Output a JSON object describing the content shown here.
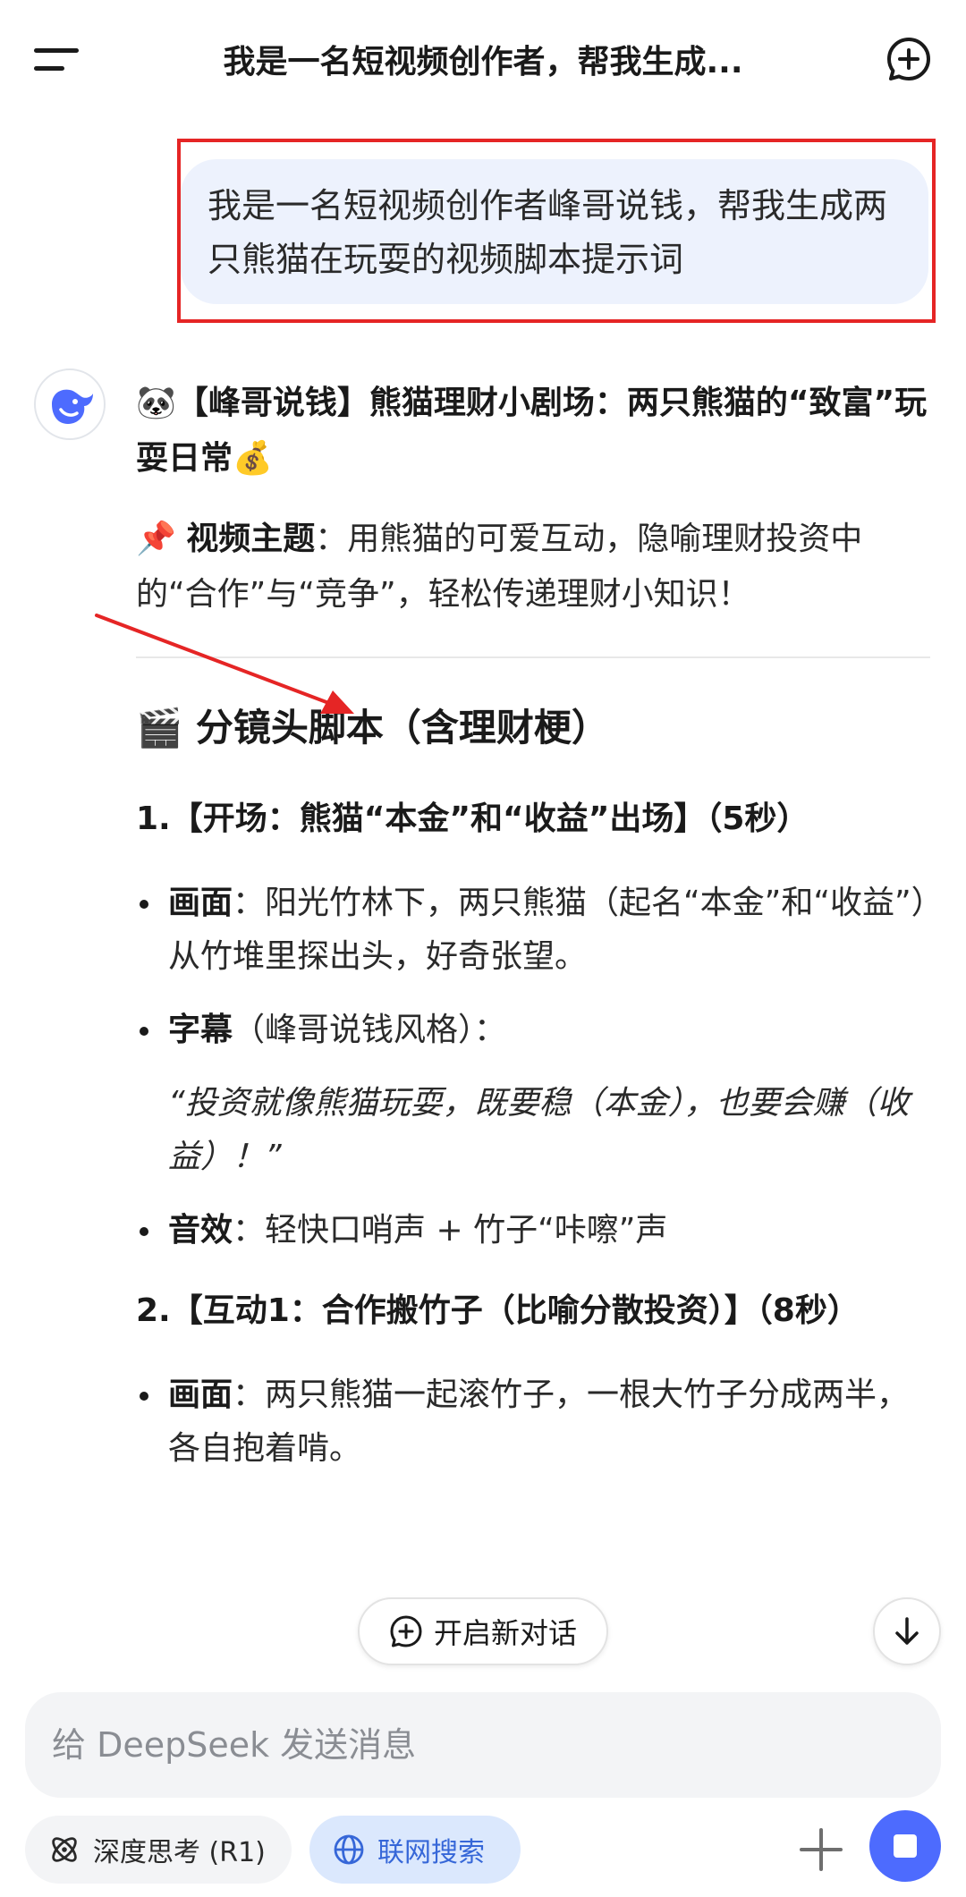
{
  "header": {
    "title": "我是一名短视频创作者，帮我生成..."
  },
  "user_message": {
    "text": "我是一名短视频创作者峰哥说钱，帮我生成两只熊猫在玩耍的视频脚本提示词"
  },
  "reply": {
    "title_emoji": "🐼",
    "title": "【峰哥说钱】熊猫理财小剧场：两只熊猫的“致富”玩耍日常",
    "title_emoji_end": "💰",
    "theme_emoji": "📌",
    "theme_label": "视频主题",
    "theme_text": "：用熊猫的可爱互动，隐喻理财投资中的“合作”与“竞争”，轻松传递理财小知识！",
    "section_emoji": "🎬",
    "section_title": "分镜头脚本（含理财梗）",
    "steps": [
      {
        "title": "1.【开场：熊猫“本金”和“收益”出场】（5秒）",
        "bullets": [
          {
            "label": "画面",
            "text": "：阳光竹林下，两只熊猫（起名“本金”和“收益”）从竹堆里探出头，好奇张望。"
          },
          {
            "label": "字幕",
            "text": "（峰哥说钱风格）：",
            "quote": "“投资就像熊猫玩耍，既要稳（本金），也要会赚（收益）！”"
          },
          {
            "label": "音效",
            "text": "：轻快口哨声 + 竹子“咔嚓”声"
          }
        ]
      },
      {
        "title": "2.【互动1：合作搬竹子（比喻分散投资）】（8秒）",
        "bullets": [
          {
            "label": "画面",
            "text": "：两只熊猫一起滚竹子，一根大竹子分成两半，各自抱着啃。"
          }
        ]
      }
    ]
  },
  "floating": {
    "new_dialog_label": "开启新对话"
  },
  "composer": {
    "placeholder": "给 DeepSeek 发送消息",
    "deep_think_label": "深度思考 (R1)",
    "web_search_label": "联网搜索"
  },
  "colors": {
    "accent": "#4d6bfe",
    "search_chip_bg": "#dbe8fd",
    "search_chip_text": "#3667d8",
    "bubble_bg": "#edf2fd",
    "annotation_red": "#e52525"
  }
}
